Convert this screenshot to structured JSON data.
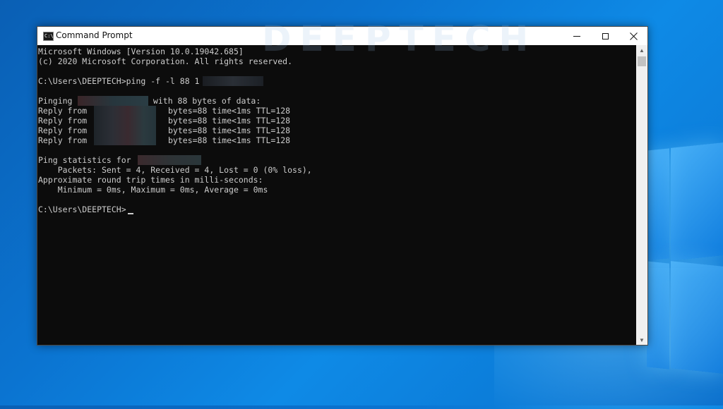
{
  "window": {
    "title": "Command Prompt"
  },
  "watermark": "DEEPTECH",
  "icons": {
    "app": "cmd-icon",
    "minimize": "minimize-icon",
    "maximize": "maximize-icon",
    "close": "close-icon",
    "scroll_up": "scroll-up-icon",
    "scroll_down": "scroll-down-icon"
  },
  "colors": {
    "console_bg": "#0c0c0c",
    "console_text": "#cccccc",
    "desktop_accent": "#0b74d1"
  },
  "console": {
    "header1": "Microsoft Windows [Version 10.0.19042.685]",
    "header2": "(c) 2020 Microsoft Corporation. All rights reserved.",
    "command": "C:\\Users\\DEEPTECH>ping -f -l 88 1",
    "pinging_prefix": "Pinging ",
    "pinging_suffix": " with 88 bytes of data:",
    "reply_prefix": "Reply from ",
    "replies": [
      "bytes=88 time<1ms TTL=128",
      "bytes=88 time<1ms TTL=128",
      "bytes=88 time<1ms TTL=128",
      "bytes=88 time<1ms TTL=128"
    ],
    "stats_header": "Ping statistics for ",
    "stats_packets": "    Packets: Sent = 4, Received = 4, Lost = 0 (0% loss),",
    "rtt_header": "Approximate round trip times in milli-seconds:",
    "rtt_values": "    Minimum = 0ms, Maximum = 0ms, Average = 0ms",
    "prompt": "C:\\Users\\DEEPTECH>"
  }
}
